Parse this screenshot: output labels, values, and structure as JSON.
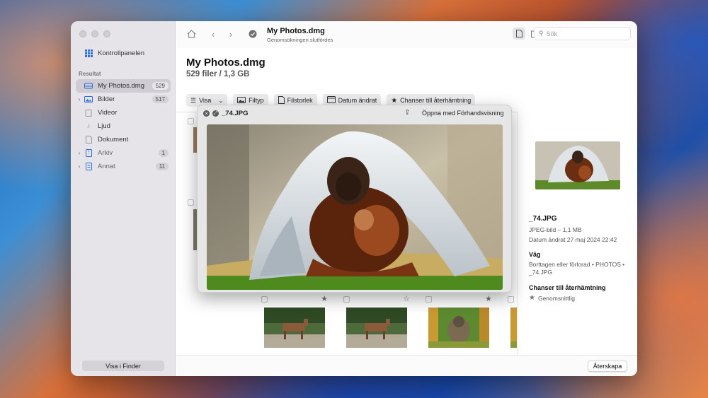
{
  "sidebar": {
    "dashboard_label": "Kontrollpanelen",
    "section_label": "Resultat",
    "items": [
      {
        "label": "My Photos.dmg",
        "badge": "529"
      },
      {
        "label": "Bilder",
        "badge": "517"
      },
      {
        "label": "Videor",
        "badge": ""
      },
      {
        "label": "Ljud",
        "badge": ""
      },
      {
        "label": "Dokument",
        "badge": ""
      },
      {
        "label": "Arkiv",
        "badge": "1"
      },
      {
        "label": "Annat",
        "badge": "11"
      }
    ],
    "finder_button": "Visa i Finder"
  },
  "toolbar": {
    "title": "My Photos.dmg",
    "subtitle": "Genomsökningen slutfördes",
    "search_placeholder": "Sök"
  },
  "header": {
    "title": "My Photos.dmg",
    "subtitle": "529 filer / 1,3 GB"
  },
  "filters": {
    "view": "Visa",
    "file_type": "Filtyp",
    "file_size": "Filstorlek",
    "date_changed": "Datum ändrat",
    "recovery_chances": "Chanser till återhämtning"
  },
  "quicklook": {
    "filename": "_74.JPG",
    "open_with": "Öppna med Förhandsvisning"
  },
  "details": {
    "filename": "_74.JPG",
    "kind": "JPEG-bild – 1,1 MB",
    "date": "Datum ändrat  27 maj 2024 22:42",
    "path_heading": "Väg",
    "path_line1": "Borttagen eller förlorad • PHOTOS •",
    "path_line2": "_74.JPG",
    "chance_heading": "Chanser till återhämtning",
    "chance_value": "Genomsnittlig"
  },
  "bottom": {
    "restore_button": "Återskapa"
  },
  "colors": {
    "sidebar_bg": "#e6e4e8",
    "selected_bg": "#cfcdd3",
    "accent_blue": "#2f6fd9"
  }
}
